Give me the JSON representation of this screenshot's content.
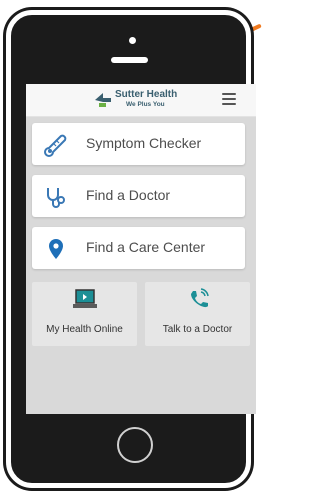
{
  "brand": {
    "name": "Sutter Health",
    "tagline": "We Plus You"
  },
  "menu_items": [
    {
      "label": "Symptom Checker",
      "icon": "thermometer-icon"
    },
    {
      "label": "Find a Doctor",
      "icon": "stethoscope-icon"
    },
    {
      "label": "Find a Care Center",
      "icon": "map-pin-icon"
    }
  ],
  "tiles": [
    {
      "label": "My Health Online",
      "icon": "laptop-icon"
    },
    {
      "label": "Talk to a Doctor",
      "icon": "phone-icon"
    }
  ],
  "colors": {
    "icon_blue": "#3a78b5",
    "pin_blue": "#1e6fb8",
    "phone_green": "#1c8f96",
    "accent_orange": "#f07a1f",
    "brand_green": "#6bb044"
  }
}
